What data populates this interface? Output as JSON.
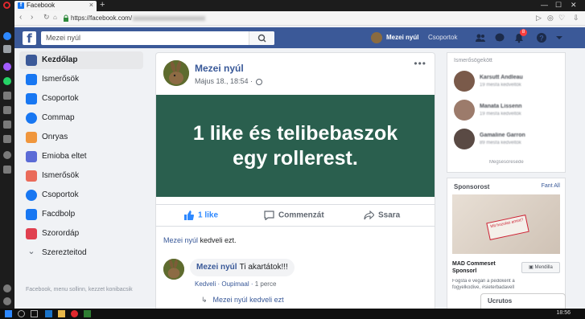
{
  "browser": {
    "tab_title": "Facebook",
    "url_prefix": "https://facebook.com/",
    "colors": {
      "chrome_dark": "#1c1c1c",
      "opera_red": "#e0282d"
    }
  },
  "fb_header": {
    "logo": "f",
    "search_placeholder": "Mezei nyúl",
    "username": "Mezei nyúl",
    "groups_link": "Csoportok",
    "notification_count": "8",
    "brand_color": "#3b5998"
  },
  "left_nav": {
    "items": [
      {
        "label": "Kezdőlap",
        "icon": "home-icon",
        "color": "#3b5998",
        "active": true
      },
      {
        "label": "Ismerősök",
        "icon": "friends-icon",
        "color": "#1877f2"
      },
      {
        "label": "Csoportok",
        "icon": "groups-icon",
        "color": "#1877f2"
      },
      {
        "label": "Commap",
        "icon": "messenger-icon",
        "color": "#1877f2"
      },
      {
        "label": "Onryas",
        "icon": "marketplace-icon",
        "color": "#f0963c"
      },
      {
        "label": "Emioba eltet",
        "icon": "watch-icon",
        "color": "#5b6bd6"
      },
      {
        "label": "Ismerősök",
        "icon": "friends-icon",
        "color": "#ea6b5a"
      },
      {
        "label": "Csoportok",
        "icon": "messenger-icon",
        "color": "#1877f2"
      },
      {
        "label": "Facdbolp",
        "icon": "groups-icon",
        "color": "#1877f2"
      },
      {
        "label": "Szorordáp",
        "icon": "pages-icon",
        "color": "#e0404f"
      },
      {
        "label": "Szerezteitod",
        "icon": "chevron-down-icon",
        "color": "#606770"
      }
    ],
    "footer": "Facebook, menu sollinn, kezzet konibacsik"
  },
  "post": {
    "author": "Mezei nyúl",
    "time": "Május 18., 18:54 ·",
    "menu": "•••",
    "text_line1": "1 like és telibebaszok",
    "text_line2": "egy rollerest.",
    "bg_color": "#2a5f4e",
    "like_label": "1 like",
    "comment_label": "Commenzát",
    "share_label": "Ssara",
    "likes_name": "Mezei nyúl",
    "likes_suffix": " kedveli ezt.",
    "comment": {
      "author": "Mezei nyúl",
      "text": "Ti akartátok!!!",
      "like_link": "Kedveli",
      "reply_link": "Oupimaal",
      "time": "1 perce"
    },
    "reply_name": "Mezei nyúl",
    "reply_text": " kedveli ezt"
  },
  "right": {
    "suggest_title": "Ismerősögekött",
    "people": [
      {
        "name": "Karsutt Andleau",
        "sub": "19 mesfa kedveltök",
        "color": "#7a5a4a"
      },
      {
        "name": "Manata Lissenn",
        "sub": "19 mesfa kedveltök",
        "color": "#9c7b6b"
      },
      {
        "name": "Gamaline Garron",
        "sub": "89 mesfa kedveltök",
        "color": "#5a4a44"
      }
    ],
    "more": "Megsésöreséde",
    "sponsored": "Sponsorost",
    "see_all": "Fant All",
    "stamp_text": "Mit hozolas amint?",
    "ad_title_line1": "MAD Commeset",
    "ad_title_line2": "Sponsorl",
    "ad_button": "Mendilla",
    "ad_desc": "Fogsta e vegán a pedoként a fogyelkodive, #sieterbadavell",
    "chat_label": "Ucrutos"
  },
  "taskbar": {
    "clock": "18:56"
  }
}
